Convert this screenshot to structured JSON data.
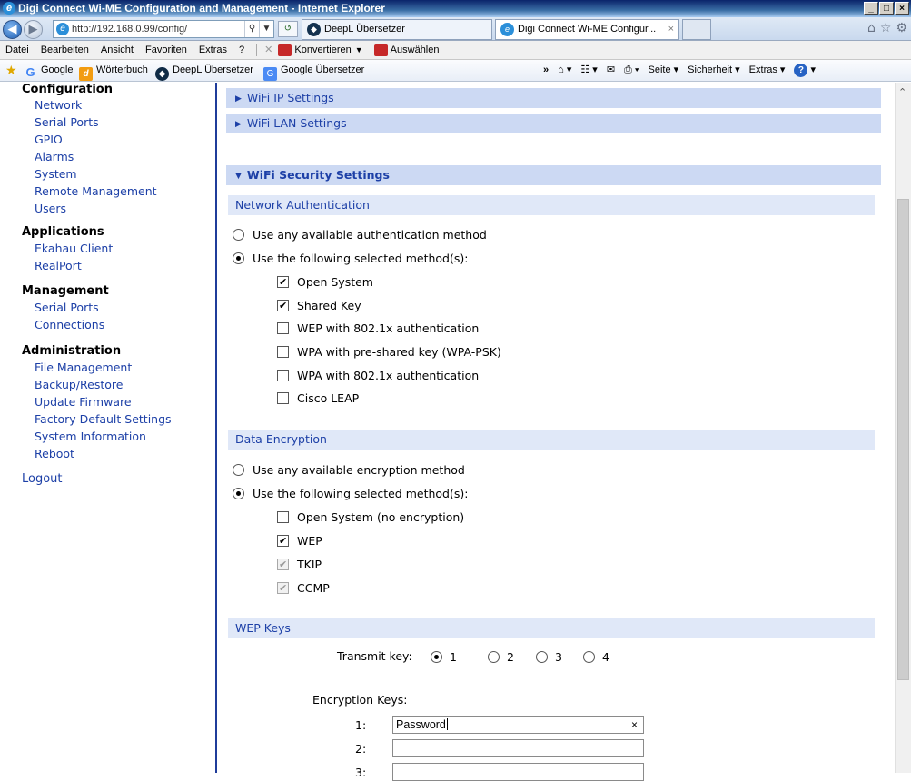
{
  "window": {
    "title": "Digi Connect Wi-ME Configuration and Management - Internet Explorer",
    "controls": [
      "_",
      "□",
      "×"
    ]
  },
  "navbar": {
    "address": "http://192.168.0.99/config/",
    "tabs": [
      {
        "label": "DeepL Übersetzer"
      },
      {
        "label": "Digi Connect Wi-ME Configur...",
        "close": "×"
      }
    ]
  },
  "menubar": {
    "items": [
      "Datei",
      "Bearbeiten",
      "Ansicht",
      "Favoriten",
      "Extras",
      "?"
    ],
    "konvertieren": "Konvertieren",
    "auswaehlen": "Auswählen"
  },
  "favbar": {
    "items": [
      "Google",
      "Wörterbuch",
      "DeepL Übersetzer",
      "Google Übersetzer"
    ],
    "commands": [
      "Seite",
      "Sicherheit",
      "Extras"
    ]
  },
  "sidebar": {
    "sections": [
      {
        "title": "Configuration",
        "links": [
          "Network",
          "Serial Ports",
          "GPIO",
          "Alarms",
          "System",
          "Remote Management",
          "Users"
        ]
      },
      {
        "title": "Applications",
        "links": [
          "Ekahau Client",
          "RealPort"
        ]
      },
      {
        "title": "Management",
        "links": [
          "Serial Ports",
          "Connections"
        ]
      },
      {
        "title": "Administration",
        "links": [
          "File Management",
          "Backup/Restore",
          "Update Firmware",
          "Factory Default Settings",
          "System Information",
          "Reboot"
        ]
      }
    ],
    "logout": "Logout"
  },
  "main": {
    "accordion": [
      {
        "label": "WiFi IP Settings",
        "open": false
      },
      {
        "label": "WiFi LAN Settings",
        "open": false
      },
      {
        "label": "WiFi Security Settings",
        "open": true
      }
    ],
    "auth": {
      "header": "Network Authentication",
      "radio_any": "Use any available authentication method",
      "radio_selected": "Use the following selected method(s):",
      "methods": [
        {
          "label": "Open System",
          "checked": true
        },
        {
          "label": "Shared Key",
          "checked": true
        },
        {
          "label": "WEP with 802.1x authentication",
          "checked": false
        },
        {
          "label": "WPA with pre-shared key (WPA-PSK)",
          "checked": false
        },
        {
          "label": "WPA with 802.1x authentication",
          "checked": false
        },
        {
          "label": "Cisco LEAP",
          "checked": false
        }
      ]
    },
    "encryption": {
      "header": "Data Encryption",
      "radio_any": "Use any available encryption method",
      "radio_selected": "Use the following selected method(s):",
      "methods": [
        {
          "label": "Open System (no encryption)",
          "checked": false,
          "disabled": false
        },
        {
          "label": "WEP",
          "checked": true,
          "disabled": false
        },
        {
          "label": "TKIP",
          "checked": true,
          "disabled": true
        },
        {
          "label": "CCMP",
          "checked": true,
          "disabled": true
        }
      ]
    },
    "wep": {
      "header": "WEP Keys",
      "transmit_label": "Transmit key:",
      "transmit_options": [
        "1",
        "2",
        "3",
        "4"
      ],
      "transmit_selected": "1",
      "keys_label": "Encryption Keys:",
      "keys": [
        {
          "label": "1:",
          "value": "Password",
          "clear": "×"
        },
        {
          "label": "2:",
          "value": ""
        },
        {
          "label": "3:",
          "value": ""
        }
      ]
    }
  }
}
